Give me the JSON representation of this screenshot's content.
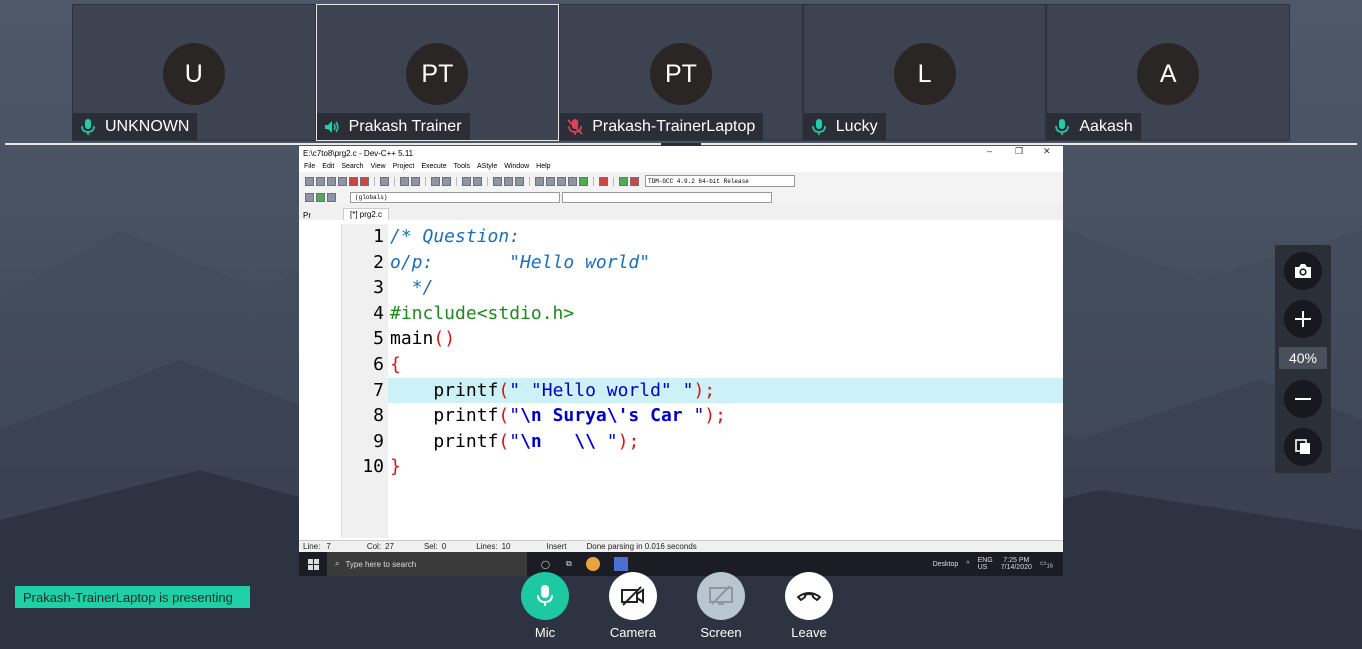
{
  "participants": [
    {
      "initials": "U",
      "name": "UNKNOWN",
      "mic": "mic-on",
      "active": false
    },
    {
      "initials": "PT",
      "name": "Prakash Trainer",
      "mic": "speaker",
      "active": true
    },
    {
      "initials": "PT",
      "name": "Prakash-TrainerLaptop",
      "mic": "mic-muted",
      "active": false
    },
    {
      "initials": "L",
      "name": "Lucky",
      "mic": "mic-on",
      "active": false
    },
    {
      "initials": "A",
      "name": "Aakash",
      "mic": "mic-on",
      "active": false
    }
  ],
  "shared_screen": {
    "window_title": "E:\\c7to8\\prg2.c - Dev-C++ 5.11",
    "window_controls": [
      "–",
      "❐",
      "✕"
    ],
    "menu": [
      "File",
      "Edit",
      "Search",
      "View",
      "Project",
      "Execute",
      "Tools",
      "AStyle",
      "Window",
      "Help"
    ],
    "compiler": "TDM-GCC 4.9.2 64-bit Release",
    "globals": "(globals)",
    "project_tab": "Pr",
    "file_tab": "[*] prg2.c",
    "line_numbers": [
      "1",
      "2",
      "3",
      "4",
      "5",
      "6",
      "7",
      "8",
      "9",
      "10"
    ],
    "status": {
      "line": "Line:",
      "line_val": "7",
      "col": "Col:",
      "col_val": "27",
      "sel": "Sel:",
      "sel_val": "0",
      "lines": "Lines:",
      "lines_val": "10",
      "mode": "Insert",
      "message": "Done parsing in 0.016 seconds"
    },
    "taskbar": {
      "search_placeholder": "Type here to search",
      "desktop": "Desktop",
      "lang": "ENG",
      "region": "US",
      "time": "7:25 PM",
      "date": "7/14/2020",
      "notif_count": "15"
    }
  },
  "zoom": {
    "level": "40%"
  },
  "presenting_banner": "Prakash-TrainerLaptop is presenting",
  "controls": [
    {
      "label": "Mic",
      "icon": "mic-icon",
      "bg": "#1ec8a0"
    },
    {
      "label": "Camera",
      "icon": "camera-off-icon",
      "bg": "#ffffff"
    },
    {
      "label": "Screen",
      "icon": "screen-share-off-icon",
      "bg": "#b9c6d0"
    },
    {
      "label": "Leave",
      "icon": "phone-hangup-icon",
      "bg": "#ffffff"
    }
  ],
  "colors": {
    "accent": "#1ed0a6",
    "muted_red": "#e0405a"
  }
}
